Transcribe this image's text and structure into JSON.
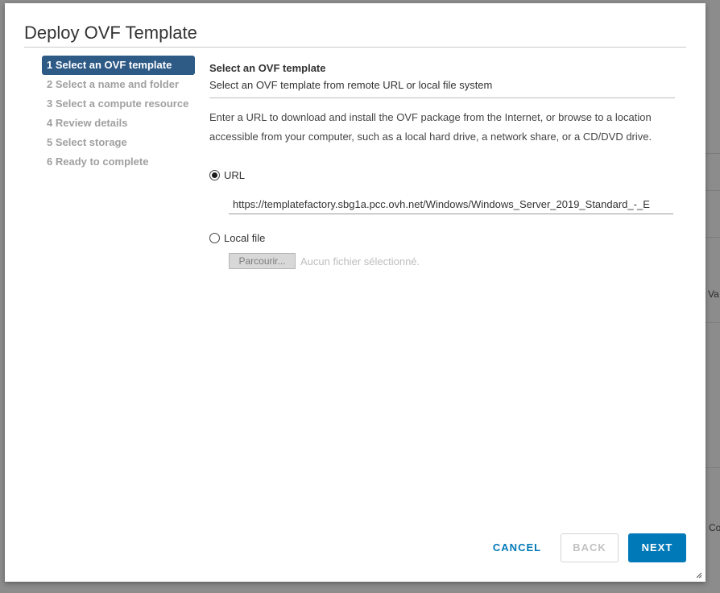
{
  "modal": {
    "title": "Deploy OVF Template"
  },
  "steps": [
    {
      "label": "1 Select an OVF template",
      "active": true
    },
    {
      "label": "2 Select a name and folder",
      "active": false
    },
    {
      "label": "3 Select a compute resource",
      "active": false
    },
    {
      "label": "4 Review details",
      "active": false
    },
    {
      "label": "5 Select storage",
      "active": false
    },
    {
      "label": "6 Ready to complete",
      "active": false
    }
  ],
  "content": {
    "heading": "Select an OVF template",
    "subheading": "Select an OVF template from remote URL or local file system",
    "description": "Enter a URL to download and install the OVF package from the Internet, or browse to a location accessible from your computer, such as a local hard drive, a network share, or a CD/DVD drive.",
    "url_option": {
      "label": "URL",
      "selected": true
    },
    "url_value": "https://templatefactory.sbg1a.pcc.ovh.net/Windows/Windows_Server_2019_Standard_-_E",
    "local_option": {
      "label": "Local file",
      "selected": false
    },
    "browse_label": "Parcourir...",
    "no_file_text": "Aucun fichier sélectionné."
  },
  "footer": {
    "cancel_label": "CANCEL",
    "back_label": "BACK",
    "next_label": "NEXT"
  },
  "colors": {
    "active_step": "#2e5a86",
    "primary": "#0079b8",
    "disabled_text": "#a0a0a0"
  },
  "background": {
    "fragments": [
      "Va",
      "Co"
    ]
  }
}
